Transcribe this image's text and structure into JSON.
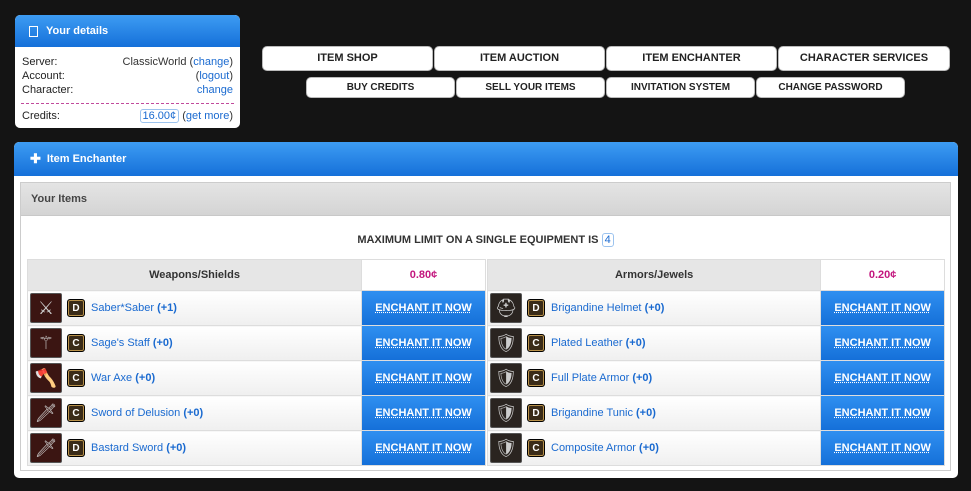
{
  "details": {
    "title": "Your details",
    "server_label": "Server:",
    "server_value": "ClassicWorld",
    "change1": "change",
    "account_label": "Account:",
    "logout": "logout",
    "character_label": "Character:",
    "change2": "change",
    "credits_label": "Credits:",
    "credits_value": "16.00¢",
    "get_more": "get more"
  },
  "nav": {
    "row1": [
      "ITEM SHOP",
      "ITEM AUCTION",
      "ITEM ENCHANTER",
      "CHARACTER SERVICES"
    ],
    "row2": [
      "BUY CREDITS",
      "SELL YOUR ITEMS",
      "INVITATION SYSTEM",
      "CHANGE PASSWORD"
    ]
  },
  "enchanter": {
    "title": "Item Enchanter",
    "section": "Your Items",
    "max_limit_text": "MAXIMUM LIMIT ON A SINGLE EQUIPMENT IS",
    "max_limit_value": "4",
    "enchant_label": "ENCHANT IT NOW",
    "weapons": {
      "header": "Weapons/Shields",
      "price": "0.80¢",
      "items": [
        {
          "grade": "D",
          "name": "Saber*Saber",
          "level": "(+1)",
          "icon": "dual-sword-icon"
        },
        {
          "grade": "C",
          "name": "Sage's Staff",
          "level": "(+0)",
          "icon": "staff-icon"
        },
        {
          "grade": "C",
          "name": "War Axe",
          "level": "(+0)",
          "icon": "axe-icon"
        },
        {
          "grade": "C",
          "name": "Sword of Delusion",
          "level": "(+0)",
          "icon": "sword-icon"
        },
        {
          "grade": "D",
          "name": "Bastard Sword",
          "level": "(+0)",
          "icon": "sword-icon"
        }
      ]
    },
    "armors": {
      "header": "Armors/Jewels",
      "price": "0.20¢",
      "items": [
        {
          "grade": "D",
          "name": "Brigandine Helmet",
          "level": "(+0)",
          "icon": "helmet-icon"
        },
        {
          "grade": "C",
          "name": "Plated Leather",
          "level": "(+0)",
          "icon": "armor-icon"
        },
        {
          "grade": "C",
          "name": "Full Plate Armor",
          "level": "(+0)",
          "icon": "armor-icon"
        },
        {
          "grade": "D",
          "name": "Brigandine Tunic",
          "level": "(+0)",
          "icon": "armor-icon"
        },
        {
          "grade": "C",
          "name": "Composite Armor",
          "level": "(+0)",
          "icon": "armor-icon"
        }
      ]
    }
  }
}
